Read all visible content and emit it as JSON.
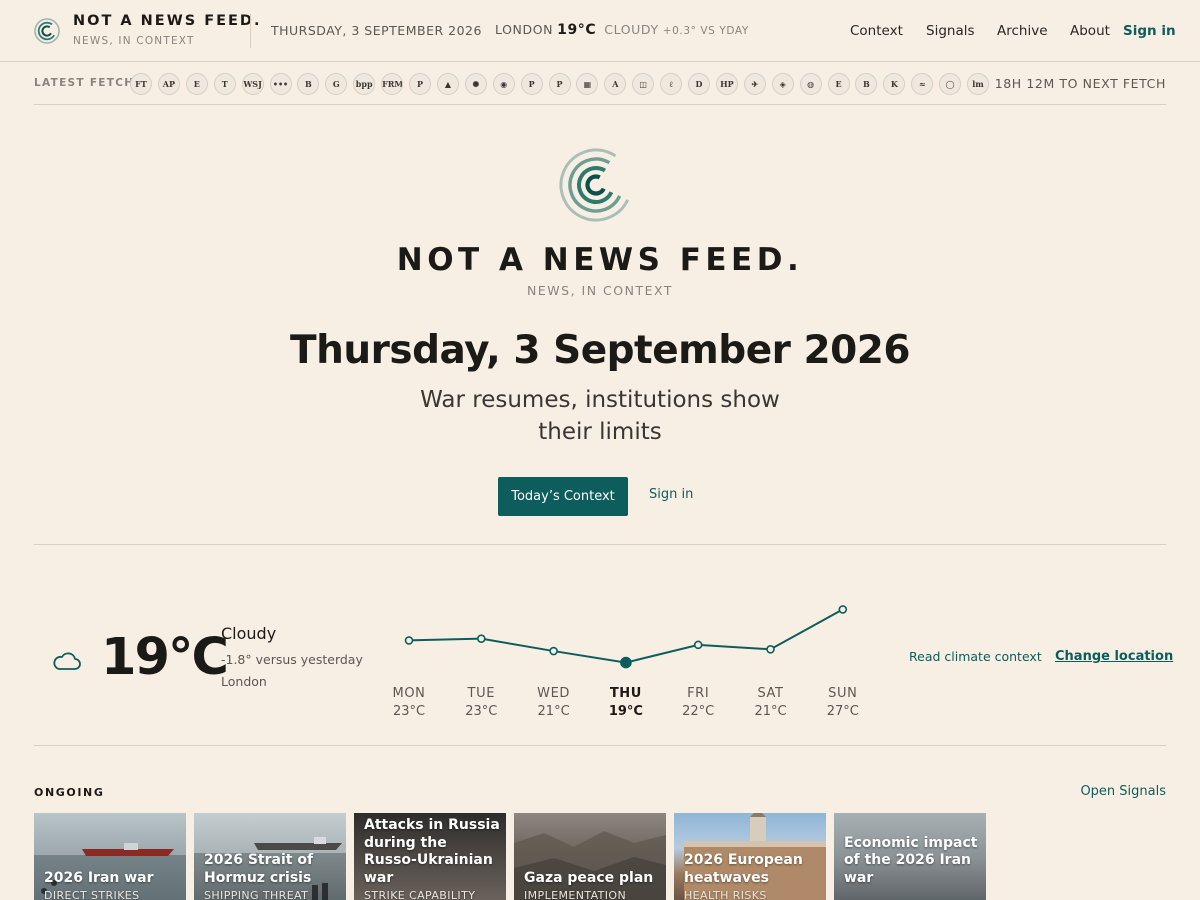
{
  "brand": {
    "name": "NOT A NEWS FEED.",
    "tagline": "NEWS, IN CONTEXT"
  },
  "topbar": {
    "date": "THURSDAY, 3 SEPTEMBER 2026",
    "weather": {
      "location": "LONDON",
      "temp": "19°C",
      "condition": "CLOUDY",
      "delta": "+0.3° VS YDAY"
    },
    "nav": [
      "Context",
      "Signals",
      "Archive",
      "About"
    ],
    "signin": "Sign in"
  },
  "fetch": {
    "label": "LATEST FETCH",
    "sources": [
      "FT",
      "AP",
      "E",
      "T",
      "WSJ",
      "•••",
      "B",
      "G",
      "bpp",
      "FRM",
      "P",
      "▲",
      "✺",
      "◉",
      "P",
      "P",
      "▦",
      "A",
      "◫",
      "ℓ",
      "D",
      "HP",
      "✈",
      "◈",
      "◍",
      "E",
      "B",
      "K",
      "≈",
      "◯",
      "lm"
    ],
    "next": "18H 12M TO NEXT FETCH"
  },
  "hero": {
    "name": "NOT A NEWS FEED.",
    "tagline": "NEWS, IN CONTEXT",
    "date": "Thursday, 3 September 2026",
    "headline": "War resumes, institutions show their limits",
    "cta": "Today’s Context",
    "signin": "Sign in"
  },
  "weather": {
    "temp": "19°C",
    "condition": "Cloudy",
    "delta": "-1.8° versus yesterday",
    "location": "London",
    "link_climate": "Read climate context",
    "link_location": "Change location",
    "icon": "cloud-icon",
    "forecast": [
      {
        "day": "MON",
        "label": "23°C",
        "value": 23,
        "current": false
      },
      {
        "day": "TUE",
        "label": "23°C",
        "value": 23.2,
        "current": false
      },
      {
        "day": "WED",
        "label": "21°C",
        "value": 21.8,
        "current": false
      },
      {
        "day": "THU",
        "label": "19°C",
        "value": 20.5,
        "current": true
      },
      {
        "day": "FRI",
        "label": "22°C",
        "value": 22.5,
        "current": false
      },
      {
        "day": "SAT",
        "label": "21°C",
        "value": 22,
        "current": false
      },
      {
        "day": "SUN",
        "label": "27°C",
        "value": 26.5,
        "current": false
      }
    ]
  },
  "ongoing": {
    "label": "ONGOING",
    "open": "Open Signals",
    "cards": [
      {
        "title": "2026 Iran war",
        "sub": "DIRECT STRIKES"
      },
      {
        "title": "2026 Strait of Hormuz crisis",
        "sub": "SHIPPING THREAT"
      },
      {
        "title": "Attacks in Russia during the Russo-Ukrainian war",
        "sub": "STRIKE CAPABILITY"
      },
      {
        "title": "Gaza peace plan",
        "sub": "IMPLEMENTATION"
      },
      {
        "title": "2026 European heatwaves",
        "sub": "HEALTH RISKS"
      },
      {
        "title": "Economic impact of the 2026 Iran war",
        "sub": ""
      }
    ]
  },
  "colors": {
    "accent": "#0d5d5c",
    "background": "#f8efe4",
    "text": "#1c1a17"
  }
}
